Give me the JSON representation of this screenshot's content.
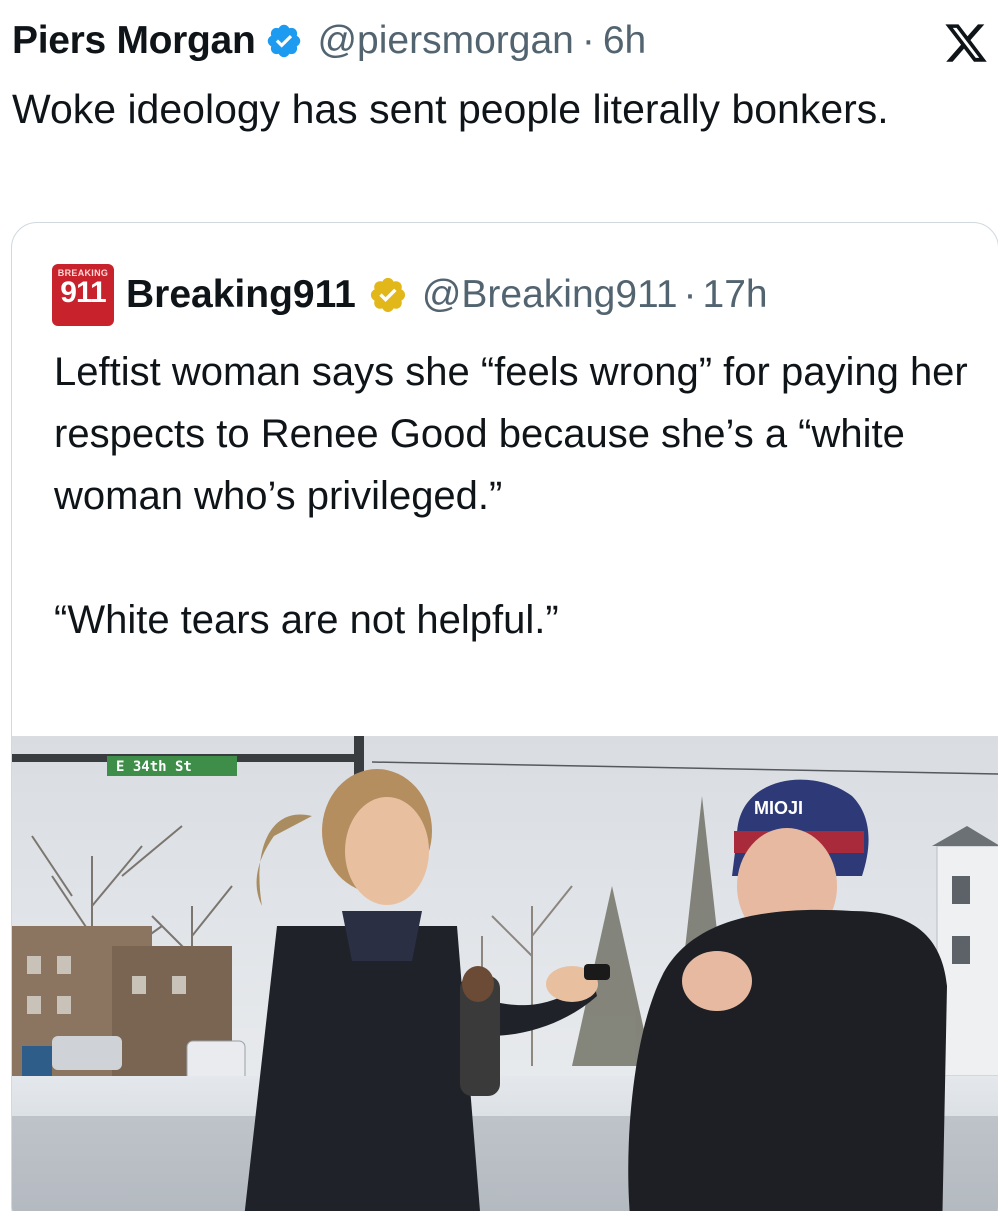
{
  "tweet": {
    "author_name": "Piers Morgan",
    "handle": "@piersmorgan",
    "separator": "·",
    "time": "6h",
    "text": "Woke ideology has sent people literally bonkers."
  },
  "quote": {
    "avatar": {
      "top_text": "BREAKING",
      "main_text": "911"
    },
    "author_name": "Breaking911",
    "handle": "@Breaking911",
    "separator": "·",
    "time": "17h",
    "text_1": "Leftist woman says she “feels wrong” for paying her respects to Renee Good because she’s a “white woman who’s privileged.”",
    "text_2": "“White tears are not helpful.”",
    "media": {
      "street_sign": "E 34th St",
      "hat_text": "MIOJI"
    }
  },
  "colors": {
    "verified_blue": "#1d9bf0",
    "verified_gold": "#e2b719",
    "secondary_text": "#536471",
    "avatar_red": "#c8232c"
  },
  "icons": {
    "verified": "verified-badge-icon",
    "close": "x-logo-icon"
  }
}
